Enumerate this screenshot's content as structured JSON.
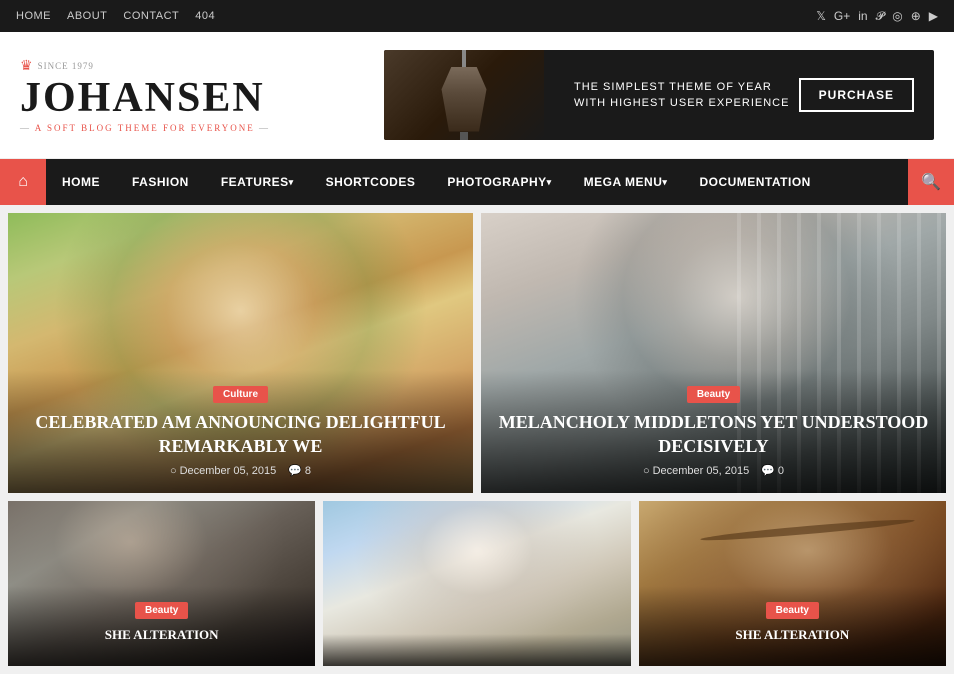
{
  "topNav": {
    "links": [
      "HOME",
      "ABOUT",
      "CONTACT",
      "404"
    ],
    "socialIcons": [
      "fb",
      "tw",
      "gp",
      "li",
      "pi",
      "ig",
      "dr",
      "yt"
    ]
  },
  "header": {
    "logoCrown": "♛",
    "since": "SINCE 1979",
    "logoText": "JOHANSEN",
    "tagline": "A SOFT BLOG THEME FOR",
    "taglineHighlight": "EVERYONE",
    "adTagline1": "THE SIMPLEST THEME OF YEAR",
    "adTagline2": "WITH HIGHEST USER EXPERIENCE",
    "purchaseLabel": "PURCHASE"
  },
  "mainNav": {
    "homeIcon": "⌂",
    "searchIcon": "🔍",
    "items": [
      {
        "label": "HOME",
        "hasArrow": false
      },
      {
        "label": "FASHION",
        "hasArrow": false
      },
      {
        "label": "FEATURES",
        "hasArrow": true
      },
      {
        "label": "SHORTCODES",
        "hasArrow": false
      },
      {
        "label": "PHOTOGRAPHY",
        "hasArrow": true
      },
      {
        "label": "MEGA MENU",
        "hasArrow": true
      },
      {
        "label": "DOCUMENTATION",
        "hasArrow": false
      }
    ]
  },
  "cards": {
    "large": [
      {
        "category": "Culture",
        "title": "CELEBRATED AM ANNOUNCING DELIGHTFUL REMARKABLY WE",
        "date": "December 05, 2015",
        "comments": "8",
        "bgClass": "img-warm"
      },
      {
        "category": "Beauty",
        "title": "MELANCHOLY MIDDLETONS YET UNDERSTOOD DECISIVELY",
        "date": "December 05, 2015",
        "comments": "0",
        "bgClass": "img-dark"
      }
    ],
    "small": [
      {
        "category": "Beauty",
        "title": "SHE ALTERATION",
        "bgClass": "img-curly"
      },
      {
        "category": "",
        "title": "",
        "bgClass": "img-smile"
      },
      {
        "category": "Beauty",
        "title": "SHE ALTERATION",
        "bgClass": "img-hat"
      }
    ]
  },
  "icons": {
    "clock": "○",
    "comment": "💬",
    "home": "⌂",
    "search": "⚲"
  }
}
